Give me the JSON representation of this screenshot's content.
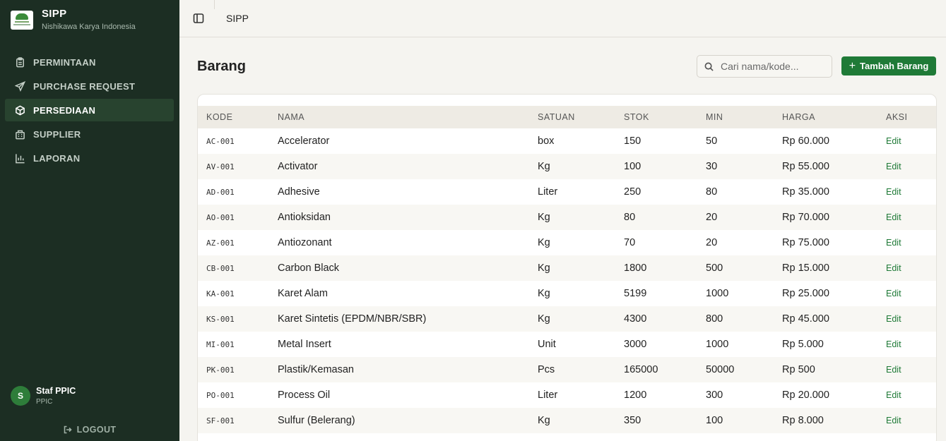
{
  "brand": {
    "title": "SIPP",
    "subtitle": "Nishikawa Karya Indonesia"
  },
  "nav": [
    {
      "label": "PERMINTAAN",
      "icon": "clipboard-icon",
      "active": false
    },
    {
      "label": "PURCHASE REQUEST",
      "icon": "send-icon",
      "active": false
    },
    {
      "label": "PERSEDIAAN",
      "icon": "box-icon",
      "active": true
    },
    {
      "label": "SUPPLIER",
      "icon": "building-icon",
      "active": false
    },
    {
      "label": "LAPORAN",
      "icon": "bar-chart-icon",
      "active": false
    }
  ],
  "user": {
    "initial": "S",
    "name": "Staf PPIC",
    "role": "PPIC"
  },
  "logout_label": "LOGOUT",
  "header": {
    "title": "SIPP"
  },
  "page": {
    "title": "Barang"
  },
  "search": {
    "placeholder": "Cari nama/kode..."
  },
  "add_button": {
    "label": "Tambah Barang"
  },
  "colors": {
    "sidebar": "#1c2e23",
    "accent": "#1f7a37",
    "active_nav": "#28432f"
  },
  "table": {
    "headers": [
      "KODE",
      "NAMA",
      "SATUAN",
      "STOK",
      "MIN",
      "HARGA",
      "AKSI"
    ],
    "action_label": "Edit",
    "rows": [
      [
        "AC-001",
        "Accelerator",
        "box",
        "150",
        "50",
        "Rp 60.000"
      ],
      [
        "AV-001",
        "Activator",
        "Kg",
        "100",
        "30",
        "Rp 55.000"
      ],
      [
        "AD-001",
        "Adhesive",
        "Liter",
        "250",
        "80",
        "Rp 35.000"
      ],
      [
        "AO-001",
        "Antioksidan",
        "Kg",
        "80",
        "20",
        "Rp 70.000"
      ],
      [
        "AZ-001",
        "Antiozonant",
        "Kg",
        "70",
        "20",
        "Rp 75.000"
      ],
      [
        "CB-001",
        "Carbon Black",
        "Kg",
        "1800",
        "500",
        "Rp 15.000"
      ],
      [
        "KA-001",
        "Karet Alam",
        "Kg",
        "5199",
        "1000",
        "Rp 25.000"
      ],
      [
        "KS-001",
        "Karet Sintetis (EPDM/NBR/SBR)",
        "Kg",
        "4300",
        "800",
        "Rp 45.000"
      ],
      [
        "MI-001",
        "Metal Insert",
        "Unit",
        "3000",
        "1000",
        "Rp 5.000"
      ],
      [
        "PK-001",
        "Plastik/Kemasan",
        "Pcs",
        "165000",
        "50000",
        "Rp 500"
      ],
      [
        "PO-001",
        "Process Oil",
        "Liter",
        "1200",
        "300",
        "Rp 20.000"
      ],
      [
        "SF-001",
        "Sulfur (Belerang)",
        "Kg",
        "350",
        "100",
        "Rp 8.000"
      ]
    ]
  }
}
